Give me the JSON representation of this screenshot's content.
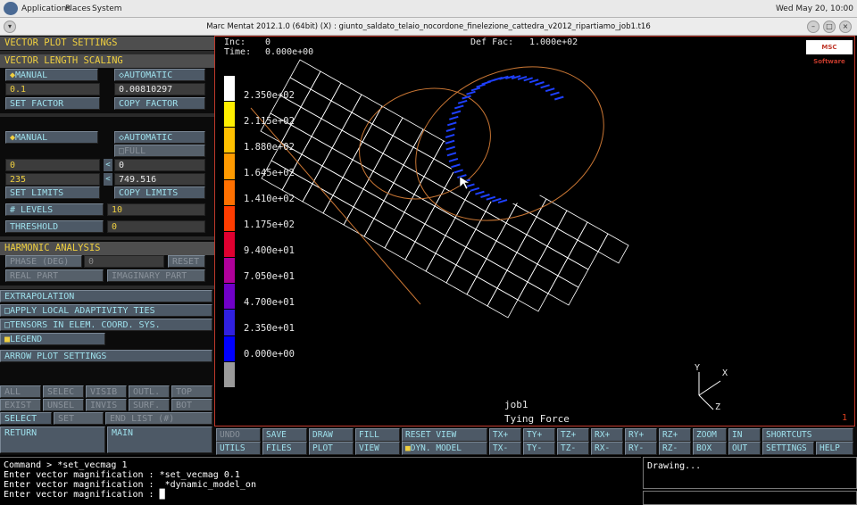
{
  "topbar": {
    "menus": [
      "Applications",
      "Places",
      "System"
    ],
    "clock": "Wed May 20, 10:00"
  },
  "window": {
    "title": "Marc Mentat 2012.1.0 (64bit) (X) : giunto_saldato_telaio_nocordone_finelezione_cattedra_v2012_ripartiamo_job1.t16"
  },
  "side": {
    "title": "VECTOR PLOT SETTINGS",
    "length_header": "VECTOR LENGTH SCALING",
    "manual": "MANUAL",
    "automatic": "AUTOMATIC",
    "factor_value": "0.1",
    "factor_auto": "0.00810297",
    "set_factor": "SET FACTOR",
    "copy_factor": "COPY FACTOR",
    "manual2": "MANUAL",
    "automatic2": "AUTOMATIC",
    "full": "FULL",
    "min_value": "0",
    "min_auto": "0",
    "max_value": "235",
    "max_auto": "749.516",
    "set_limits": "SET LIMITS",
    "copy_limits": "COPY LIMITS",
    "levels_label": "# LEVELS",
    "levels_value": "10",
    "threshold_label": "THRESHOLD",
    "threshold_value": "0",
    "harmonic": "HARMONIC ANALYSIS",
    "phase": "PHASE (DEG)",
    "phase_value": "0",
    "reset": "RESET",
    "real_part": "REAL PART",
    "imag_part": "IMAGINARY PART",
    "extrapolation": "EXTRAPOLATION",
    "adaptivity": "APPLY LOCAL ADAPTIVITY TIES",
    "tensors": "TENSORS IN ELEM. COORD. SYS.",
    "legend": "LEGEND",
    "arrow": "ARROW PLOT SETTINGS",
    "sel_row1": [
      "ALL",
      "SELEC",
      "VISIB",
      "OUTL.",
      "TOP"
    ],
    "sel_row2": [
      "EXIST",
      "UNSEL",
      "INVIS",
      "SURF.",
      "BOT"
    ],
    "select": "SELECT",
    "set": "SET",
    "end_list": "END LIST (#)",
    "return": "RETURN",
    "main": "MAIN"
  },
  "viewport": {
    "inc_label": "Inc:",
    "inc_value": "0",
    "time_label": "Time:",
    "time_value": "0.000e+00",
    "deffac_label": "Def Fac:",
    "deffac_value": "1.000e+02",
    "brand": "MSC Software",
    "legend": [
      "2.350e+02",
      "2.115e+02",
      "1.880e+02",
      "1.645e+02",
      "1.410e+02",
      "1.175e+02",
      "9.400e+01",
      "7.050e+01",
      "4.700e+01",
      "2.350e+01",
      "0.000e+00"
    ],
    "legend_colors": [
      "#ffffff",
      "#ffee00",
      "#ffc000",
      "#ff9a00",
      "#ff7000",
      "#ff3c00",
      "#e00030",
      "#b0009a",
      "#7000c8",
      "#3020e0",
      "#0000ff",
      "#9a9a9a"
    ],
    "job": "job1",
    "result": "Tying Force",
    "window_number": "1",
    "axes": {
      "x": "X",
      "y": "Y",
      "z": "Z"
    }
  },
  "toolbar": {
    "row1": [
      "UNDO",
      "SAVE",
      "DRAW",
      "FILL",
      "RESET VIEW",
      "TX+",
      "TY+",
      "TZ+",
      "RX+",
      "RY+",
      "RZ+",
      "ZOOM",
      "IN",
      "SHORTCUTS"
    ],
    "row2": [
      "UTILS",
      "FILES",
      "PLOT",
      "VIEW",
      "DYN. MODEL",
      "TX-",
      "TY-",
      "TZ-",
      "RX-",
      "RY-",
      "RZ-",
      "BOX",
      "OUT",
      "SETTINGS",
      "HELP"
    ]
  },
  "console": {
    "lines": [
      "Command > *set_vecmag 1",
      "Enter vector magnification : *set_vecmag 0.1",
      "Enter vector magnification :  *dynamic_model_on",
      "Enter vector magnification : █"
    ],
    "status": "Drawing..."
  }
}
